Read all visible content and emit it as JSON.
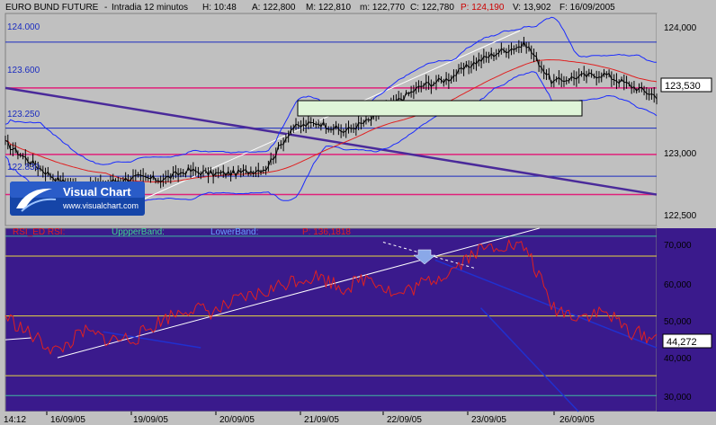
{
  "header": {
    "instrument": "EURO BUND FUTURE",
    "timeframe": "Intradia 12 minutos",
    "high": "H: 10:48",
    "open": "A: 122,800",
    "max": "M: 122,810",
    "min": "m: 122,770",
    "close": "C: 122,780",
    "prev": "P: 124,190",
    "volume": "V: 13,902",
    "date": "F: 16/09/2005"
  },
  "logo": {
    "brand": "Visual Chart",
    "url": "www.visualchart.com"
  },
  "price_panel": {
    "level_labels": [
      "124.000",
      "123.600",
      "123.250",
      "122.830"
    ],
    "level_values": [
      124.0,
      123.6,
      123.25,
      122.83
    ],
    "y_ticks": [
      "124,000",
      "123,000",
      "122,500"
    ],
    "y_tick_values": [
      124.0,
      123.0,
      122.5
    ],
    "last_price_tag": "123,530",
    "last_price_value": 123.53
  },
  "rsi_panel": {
    "legend": {
      "rsi": "RSI_ED  RSI:",
      "upper": "UppperBand:",
      "lower": "LowerBand:",
      "p": "P: 136,1818"
    },
    "y_ticks": [
      "70,000",
      "60,000",
      "50,000",
      "40,000",
      "30,000"
    ],
    "y_tick_values": [
      70,
      60,
      50,
      40,
      30
    ],
    "last_rsi_tag": "44,272",
    "last_rsi_value": 44.272
  },
  "x_axis": {
    "labels": [
      "14:12",
      "16/09/05",
      "19/09/05",
      "20/09/05",
      "21/09/05",
      "22/09/05",
      "23/09/05",
      "26/09/05"
    ]
  },
  "colors": {
    "price_bg": "#c0c0c0",
    "rsi_bg": "#3a1a8c",
    "blue_line": "#1a2bbf",
    "magenta_line": "#e0207a",
    "red_ma": "#e02020",
    "bollinger": "#1a2bff",
    "trend_purple": "#4a2a9a",
    "rsi_line": "#e02020",
    "rsi_yellow": "#e8d840",
    "rsi_green": "#40b8a0",
    "white": "#ffffff"
  },
  "chart_data": {
    "type": "line",
    "title": "EURO BUND FUTURE - Intradia 12 minutos",
    "price_series": {
      "name": "EURO BUND FUTURE",
      "x": [
        0,
        4,
        8,
        12,
        16,
        20,
        24,
        28,
        32,
        36,
        40,
        44,
        48,
        52,
        56,
        60,
        64,
        68,
        72,
        76,
        80,
        84,
        88,
        92,
        96,
        100
      ],
      "values": [
        123.12,
        122.95,
        122.8,
        122.72,
        122.78,
        122.82,
        122.8,
        122.88,
        122.85,
        122.86,
        122.9,
        123.25,
        123.3,
        123.22,
        123.32,
        123.48,
        123.62,
        123.68,
        123.82,
        123.92,
        123.98,
        123.65,
        123.7,
        123.72,
        123.62,
        123.53
      ]
    },
    "rsi_series": {
      "name": "RSI",
      "x": [
        0,
        4,
        8,
        12,
        16,
        20,
        24,
        28,
        32,
        36,
        40,
        44,
        48,
        52,
        56,
        60,
        64,
        68,
        72,
        76,
        80,
        84,
        88,
        92,
        96,
        100
      ],
      "values": [
        50,
        45,
        41,
        46,
        44,
        44.5,
        49,
        52,
        51,
        54,
        56,
        59,
        60,
        57,
        60,
        55,
        58,
        61,
        66,
        68,
        67,
        52,
        50,
        51,
        46,
        44.272
      ]
    },
    "y_range_price": [
      122.4,
      124.25
    ],
    "y_range_rsi": [
      26,
      72
    ],
    "xlabel": "",
    "ylabel": "",
    "grid": false
  }
}
